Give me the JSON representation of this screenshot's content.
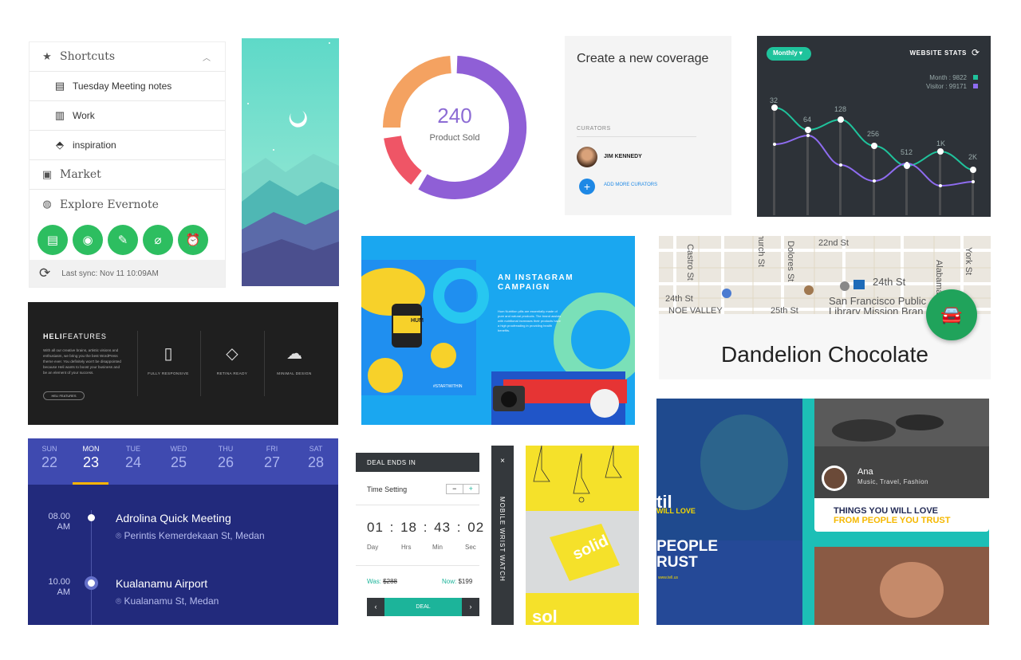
{
  "evernote": {
    "shortcuts": "Shortcuts",
    "items": [
      "Tuesday Meeting notes",
      "Work",
      "inspiration"
    ],
    "market": "Market",
    "explore": "Explore Evernote",
    "sync": "Last sync: Nov 11 10:09AM",
    "accent": "#2dbe60"
  },
  "donut": {
    "value": "240",
    "label": "Product Sold"
  },
  "coverage": {
    "title": "Create a new coverage",
    "curators_label": "CURATORS",
    "curator_name": "JIM KENNEDY",
    "add_label": "ADD MORE CURATORS"
  },
  "stats": {
    "period": "Monthly",
    "title": "WEBSITE STATS",
    "month_legend": "Month : 9822",
    "visitor_legend": "Visitor : 99171",
    "labels": [
      "32",
      "64",
      "128",
      "256",
      "512",
      "1K",
      "2K"
    ],
    "colors": {
      "month": "#1fc39c",
      "visitor": "#8e6cf0"
    }
  },
  "heli": {
    "brand_bold": "HELI",
    "brand_rest": "FEATURES",
    "body": "With all our creative brains, artistic visions and enthusiasm, we bring you the best WordPress theme ever. You definitely won't be disappointed because Heli wants to boost your business and be an element of your success.",
    "button": "HELI FEATURES",
    "features": [
      "FULLY RESPONSIVE",
      "RETINA READY",
      "MINIMAL DESIGN"
    ]
  },
  "instagram": {
    "title": "AN INSTAGRAM CAMPAIGN",
    "body": "Hum Nutrition pills are essentially made of pure and natural products. The brand assists with nutritional increases their products have a high proofreading in providing health benefits.",
    "hashtag": "#STARTWITHIN",
    "product": "HUM"
  },
  "map": {
    "streets": [
      "22nd St",
      "24th St",
      "24th St",
      "Castro St",
      "Dolores St",
      "Church St",
      "York St",
      "Alabama"
    ],
    "place": "San Francisco Public",
    "place2": "Library Mission Bran",
    "neighborhood": "NOE VALLEY",
    "street_25": "25th St",
    "name": "Dandelion Chocolate"
  },
  "calendar": {
    "days": [
      {
        "name": "SUN",
        "date": "22"
      },
      {
        "name": "MON",
        "date": "23"
      },
      {
        "name": "TUE",
        "date": "24"
      },
      {
        "name": "WED",
        "date": "25"
      },
      {
        "name": "THU",
        "date": "26"
      },
      {
        "name": "FRI",
        "date": "27"
      },
      {
        "name": "SAT",
        "date": "28"
      }
    ],
    "events": [
      {
        "time": "08.00",
        "ampm": "AM",
        "title": "Adrolina Quick Meeting",
        "location": "Perintis Kemerdekaan St, Medan"
      },
      {
        "time": "10.00",
        "ampm": "AM",
        "title": "Kualanamu Airport",
        "location": "Kualanamu St, Medan"
      }
    ]
  },
  "deal": {
    "header": "DEAL ENDS IN",
    "setting": "Time Setting",
    "minus": "−",
    "plus": "+",
    "timer": "01 : 18 : 43 : 02",
    "units": [
      "Day",
      "Hrs",
      "Min",
      "Sec"
    ],
    "was_label": "Was:",
    "was_value": "$288",
    "now_label": "Now:",
    "now_value": "$199",
    "button": "DEAL",
    "side_title": "MOBILE WRIST WATCH",
    "close": "×"
  },
  "solid": {
    "word": "solid",
    "word_short": "sol"
  },
  "persona": {
    "name": "Ana",
    "tags": "Music, Travel, Fashion",
    "line1": "THINGS YOU WILL LOVE",
    "line2": "FROM PEOPLE YOU TRUST",
    "big1": "til",
    "big2": "WILL LOVE",
    "big3": "PEOPLE",
    "big4": "RUST",
    "url": "www.tell.us"
  }
}
